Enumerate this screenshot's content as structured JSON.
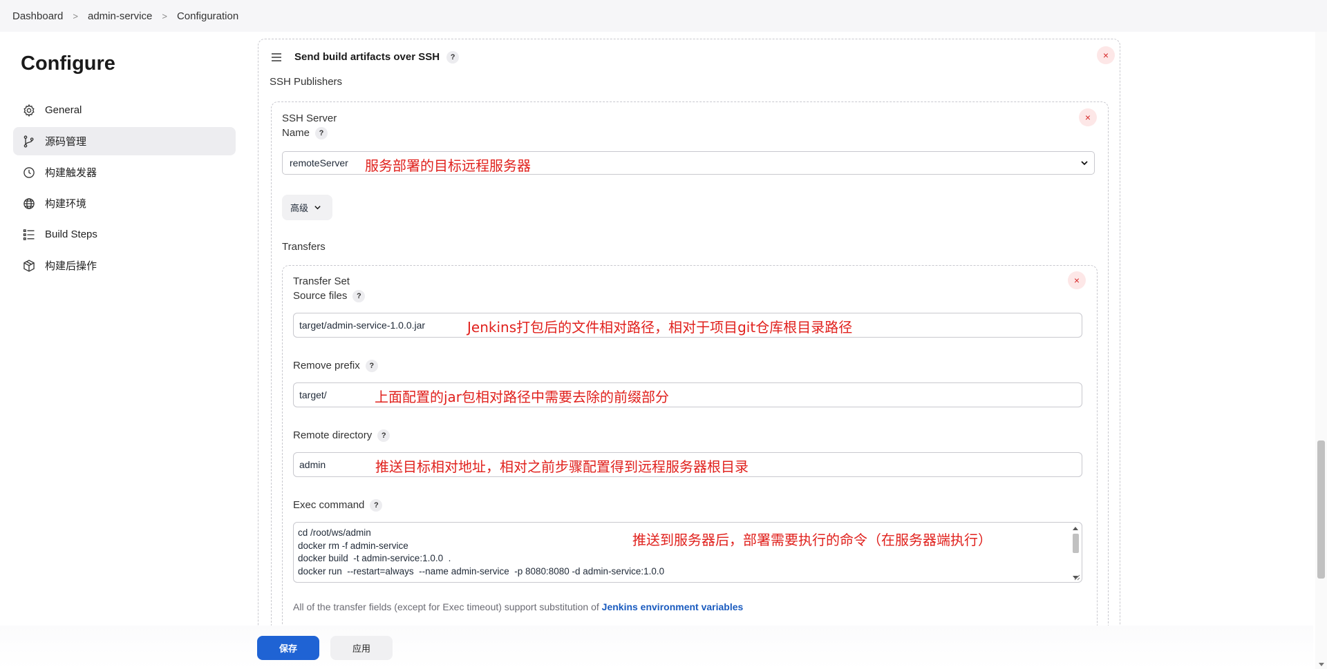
{
  "breadcrumb": [
    "Dashboard",
    "admin-service",
    "Configuration"
  ],
  "sidebar": {
    "title": "Configure",
    "items": [
      {
        "label": "General",
        "icon": "gear-icon"
      },
      {
        "label": "源码管理",
        "icon": "branch-icon"
      },
      {
        "label": "构建触发器",
        "icon": "timer-icon"
      },
      {
        "label": "构建环境",
        "icon": "globe-icon"
      },
      {
        "label": "Build Steps",
        "icon": "list-icon"
      },
      {
        "label": "构建后操作",
        "icon": "package-icon"
      }
    ]
  },
  "publisher": {
    "title": "Send build artifacts over SSH",
    "help": "?",
    "close": "×",
    "ssh_publishers_label": "SSH Publishers",
    "server": {
      "section_label": "SSH Server",
      "name_label": "Name",
      "name_value": "remoteServer",
      "name_annotation": "服务部署的目标远程服务器",
      "advanced_label": "高级",
      "transfers_label": "Transfers",
      "transfer_set": {
        "section_label": "Transfer Set",
        "source_files_label": "Source files",
        "source_files_value": "target/admin-service-1.0.0.jar",
        "source_files_annotation": "Jenkins打包后的文件相对路径，相对于项目git仓库根目录路径",
        "remove_prefix_label": "Remove prefix",
        "remove_prefix_value": "target/",
        "remove_prefix_annotation": "上面配置的jar包相对路径中需要去除的前缀部分",
        "remote_directory_label": "Remote directory",
        "remote_directory_value": "admin",
        "remote_directory_annotation": "推送目标相对地址，相对之前步骤配置得到远程服务器根目录",
        "exec_command_label": "Exec command",
        "exec_command_lines": [
          "cd /root/ws/admin",
          "docker rm -f admin-service",
          "docker build  -t admin-service:1.0.0  .",
          "docker run  --restart=always  --name admin-service  -p 8080:8080 -d admin-service:1.0.0"
        ],
        "exec_command_annotation": "推送到服务器后，部署需要执行的命令（在服务器端执行）",
        "hint_text": "All of the transfer fields (except for Exec timeout) support substitution of ",
        "hint_link": "Jenkins environment variables"
      }
    }
  },
  "footer": {
    "save_label": "保存",
    "apply_label": "应用"
  },
  "colors": {
    "accent": "#1f63d4",
    "annotation": "#e0211d",
    "close": "#d62828"
  }
}
